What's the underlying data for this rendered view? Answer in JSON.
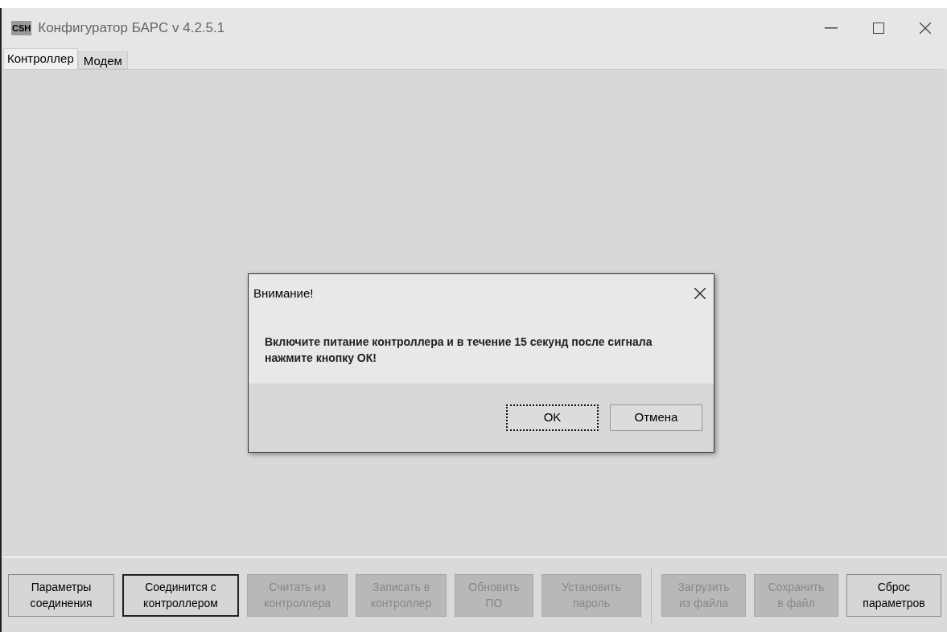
{
  "window": {
    "title": "Конфигуратор БАРС v 4.2.5.1",
    "logo": "CSH"
  },
  "tabs": [
    {
      "label": "Контроллер",
      "selected": true
    },
    {
      "label": "Модем",
      "selected": false
    }
  ],
  "toolbar": {
    "left_buttons": [
      {
        "label": "Параметры соединения",
        "disabled": false,
        "focused": false
      },
      {
        "label": "Соединится с контроллером",
        "disabled": false,
        "focused": true
      },
      {
        "label": "Считать из контроллера",
        "disabled": true,
        "focused": false
      },
      {
        "label": "Записать в контроллер",
        "disabled": true,
        "focused": false
      },
      {
        "label": "Обновить ПО",
        "disabled": true,
        "focused": false
      },
      {
        "label": "Установить пароль",
        "disabled": true,
        "focused": false
      }
    ],
    "right_buttons": [
      {
        "label": "Загрузить из файла",
        "disabled": true,
        "focused": false
      },
      {
        "label": "Сохранить в файл",
        "disabled": true,
        "focused": false
      },
      {
        "label": "Сброс параметров",
        "disabled": false,
        "focused": false
      }
    ]
  },
  "dialog": {
    "title": "Внимание!",
    "message": "Включите питание контроллера и в течение 15 секунд после сигнала нажмите кнопку ОК!",
    "buttons": [
      {
        "label": "OK",
        "focused": true
      },
      {
        "label": "Отмена",
        "focused": false
      }
    ]
  }
}
